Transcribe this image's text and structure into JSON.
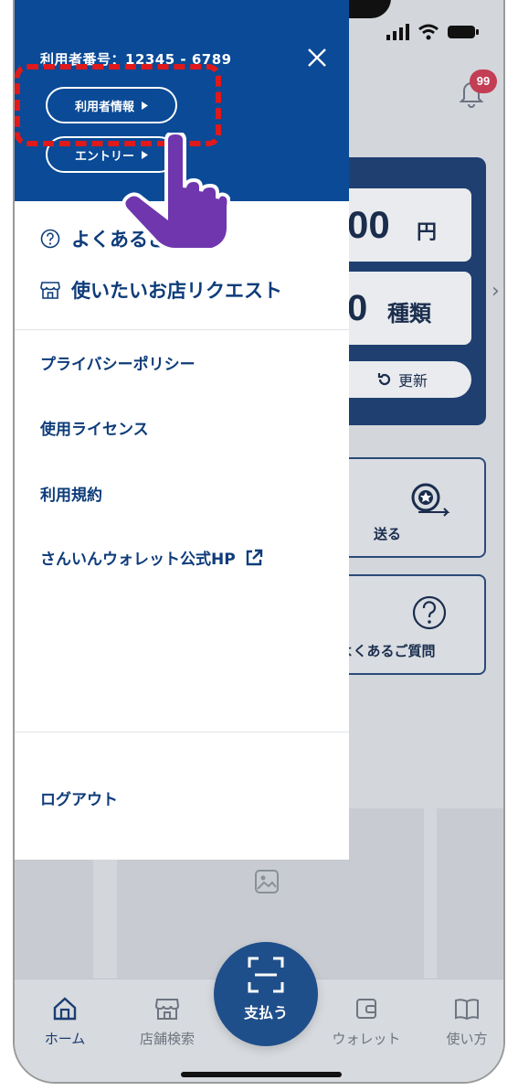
{
  "status": {
    "signal_icon": "signal-bars-icon",
    "wifi_icon": "wifi-icon",
    "battery_icon": "battery-icon"
  },
  "background": {
    "notification_badge": "99",
    "balance_amount": "00",
    "balance_unit": "円",
    "coupon_count": "0",
    "coupon_unit": "種類",
    "refresh_label": "更新",
    "tiles": [
      {
        "label": "送る"
      },
      {
        "label": "よくあるご質問"
      }
    ],
    "tabs": [
      {
        "label": "ホーム",
        "icon": "home-icon"
      },
      {
        "label": "店舗検索",
        "icon": "store-icon"
      },
      {
        "label": "ウォレット",
        "icon": "wallet-icon"
      },
      {
        "label": "使い方",
        "icon": "book-icon"
      }
    ],
    "pay_label": "支払う"
  },
  "drawer": {
    "user_number": "利用者番号：12345 - 6789",
    "user_info_label": "利用者情報",
    "entry_label": "エントリー",
    "primary_items": [
      {
        "label": "よくあるご質問",
        "icon": "question-circle-icon"
      },
      {
        "label": "使いたいお店リクエスト",
        "icon": "store-icon"
      }
    ],
    "secondary_items": [
      {
        "label": "プライバシーポリシー"
      },
      {
        "label": "使用ライセンス"
      },
      {
        "label": "利用規約"
      },
      {
        "label": "さんいんウォレット公式HP",
        "icon": "external-link-icon"
      }
    ],
    "logout_label": "ログアウト"
  },
  "colors": {
    "drawer_header": "#0a4a96",
    "menu_text": "#0e3c7a",
    "highlight": "#e0191b",
    "hand": "#6f36ad",
    "badge": "#c33d55"
  }
}
